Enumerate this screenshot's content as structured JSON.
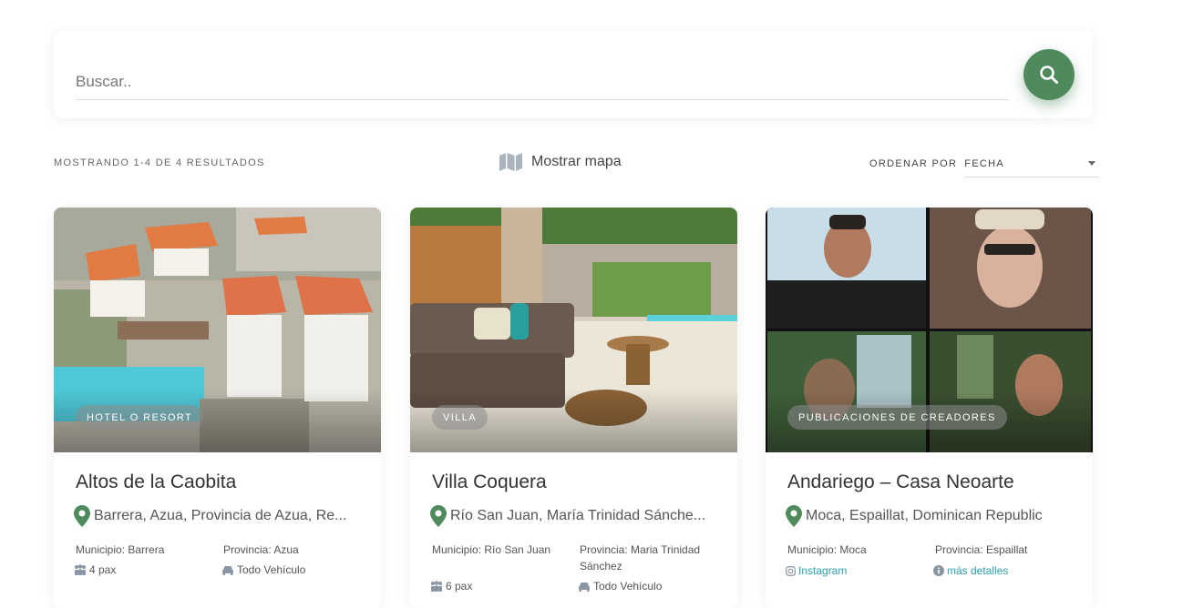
{
  "search": {
    "placeholder": "Buscar.."
  },
  "toolbar": {
    "results_text": "MOSTRANDO 1-4 DE 4 RESULTADOS",
    "map_label": "Mostrar mapa",
    "sort_label": "ORDENAR POR",
    "sort_value": "FECHA"
  },
  "colors": {
    "accent": "#4f8a5d",
    "link": "#2a9fb0"
  },
  "cards": [
    {
      "badge": "HOTEL O RESORT",
      "title": "Altos de la Caobita",
      "location": "Barrera, Azua, Provincia de Azua, Re...",
      "municipio": "Municipio: Barrera",
      "provincia": "Provincia: Azua",
      "pax": "4 pax",
      "vehiculo": "Todo Vehículo"
    },
    {
      "badge": "VILLA",
      "title": "Villa Coquera",
      "location": "Río San Juan, María Trinidad Sánche...",
      "municipio": "Municipio: Río San Juan",
      "provincia": "Provincia: Maria Trinidad Sánchez",
      "pax": "6 pax",
      "vehiculo": "Todo Vehículo"
    },
    {
      "badge": "PUBLICACIONES DE CREADORES",
      "title": "Andariego – Casa Neoarte",
      "location": "Moca, Espaillat, Dominican Republic",
      "municipio": "Municipio: Moca",
      "provincia": "Provincia: Espaillat",
      "instagram": "Instagram",
      "details": "más detalles"
    }
  ]
}
